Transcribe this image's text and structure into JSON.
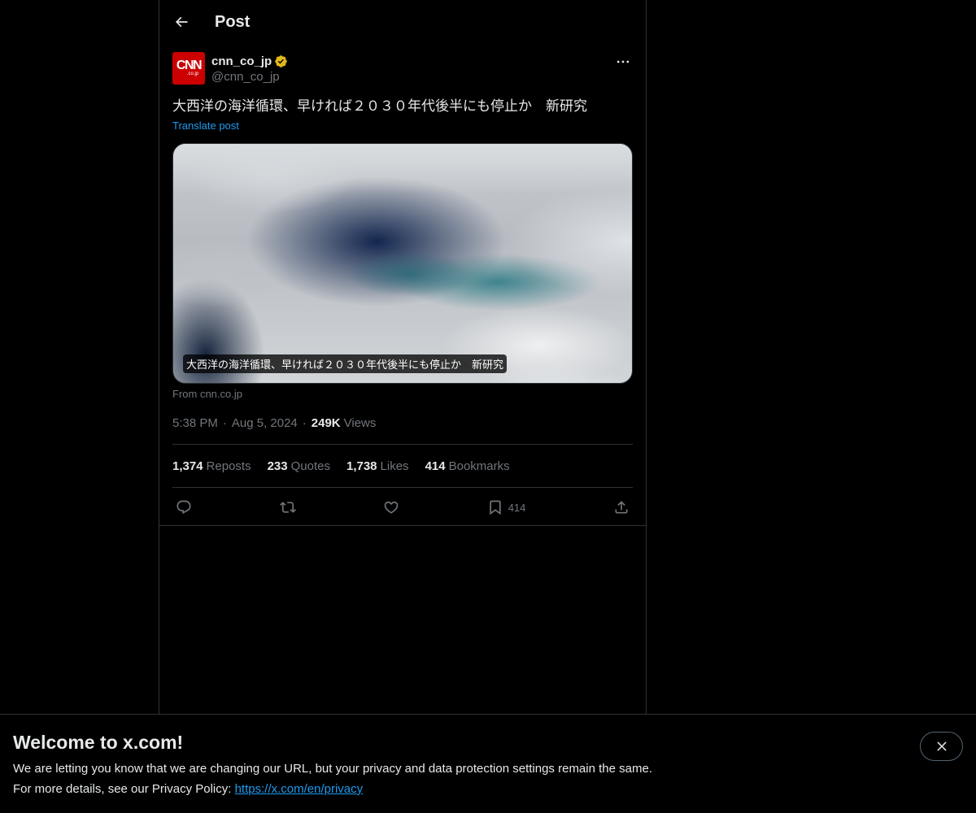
{
  "header": {
    "title": "Post"
  },
  "author": {
    "avatar_text": "CNN",
    "avatar_subtext": ".co.jp",
    "display_name": "cnn_co_jp",
    "handle": "@cnn_co_jp"
  },
  "post": {
    "text": "大西洋の海洋循環、早ければ２０３０年代後半にも停止か　新研究",
    "translate_label": "Translate post",
    "media_caption": "大西洋の海洋循環、早ければ２０３０年代後半にも停止か　新研究",
    "source": "From cnn.co.jp",
    "time": "5:38 PM",
    "date": "Aug 5, 2024",
    "views_count": "249K",
    "views_label": "Views"
  },
  "stats": {
    "reposts_count": "1,374",
    "reposts_label": "Reposts",
    "quotes_count": "233",
    "quotes_label": "Quotes",
    "likes_count": "1,738",
    "likes_label": "Likes",
    "bookmarks_count": "414",
    "bookmarks_label": "Bookmarks"
  },
  "actions": {
    "bookmark_count": "414"
  },
  "colors": {
    "background": "#000000",
    "text": "#e7e9ea",
    "muted": "#71767b",
    "accent": "#1d9bf0",
    "verified_gold": "#e2b719",
    "avatar_red": "#cc0000"
  },
  "banner": {
    "title": "Welcome to x.com!",
    "line1": "We are letting you know that we are changing our URL, but your privacy and data protection settings remain the same.",
    "line2_prefix": "For more details, see our Privacy Policy: ",
    "link": "https://x.com/en/privacy"
  },
  "icons": [
    "back-arrow-icon",
    "verified-badge-icon",
    "more-icon",
    "reply-icon",
    "repost-icon",
    "like-icon",
    "bookmark-icon",
    "share-icon",
    "close-icon"
  ]
}
